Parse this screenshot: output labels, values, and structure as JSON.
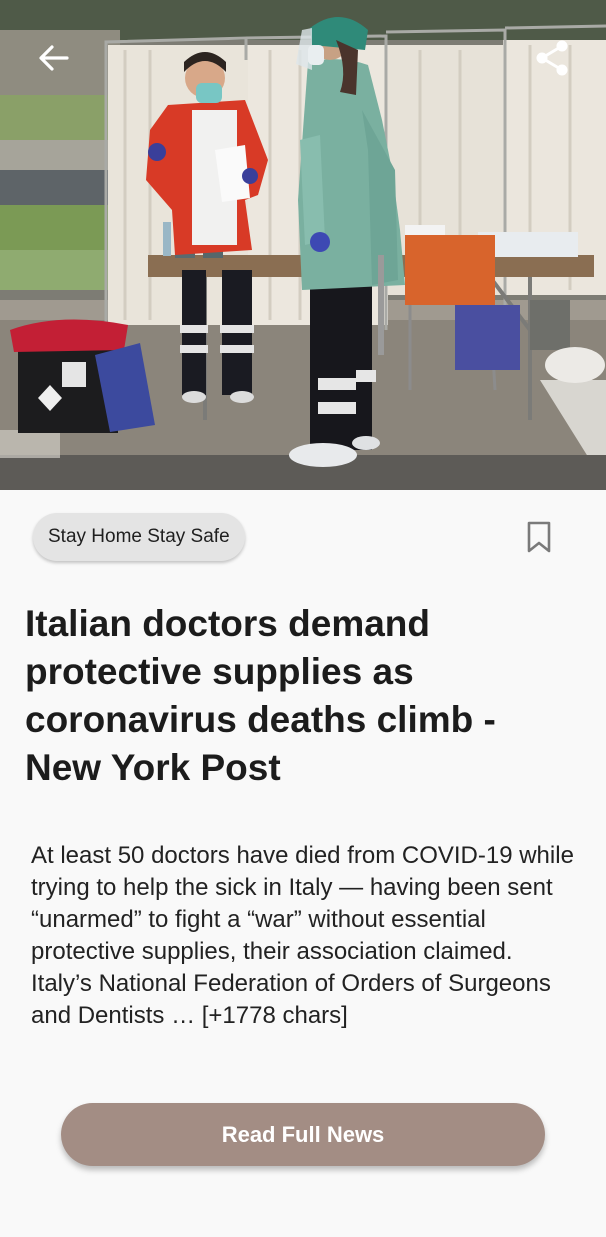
{
  "toolbar": {
    "back_icon": "arrow-left-icon",
    "share_icon": "share-icon"
  },
  "article": {
    "image_icon": "news-photo",
    "tag": "Stay Home Stay Safe",
    "bookmark_icon": "bookmark-outline-icon",
    "headline": "Italian doctors demand protective supplies as coronavirus deaths climb - New York Post",
    "summary_line1": "At least 50 doctors have died from COVID-19 while trying to help the sick in Italy — having been sent “unarmed” to fight a “war” without essential protective supplies, their association claimed.",
    "summary_line2": "Italy’s National Federation of Orders of Surgeons and Dentists … [+1778 chars]",
    "read_button_label": "Read Full News"
  },
  "colors": {
    "background": "#f9f9f9",
    "chip": "#e4e4e4",
    "button": "#a38d84",
    "button_text": "#ffffff",
    "headline": "#1c1c1c"
  }
}
